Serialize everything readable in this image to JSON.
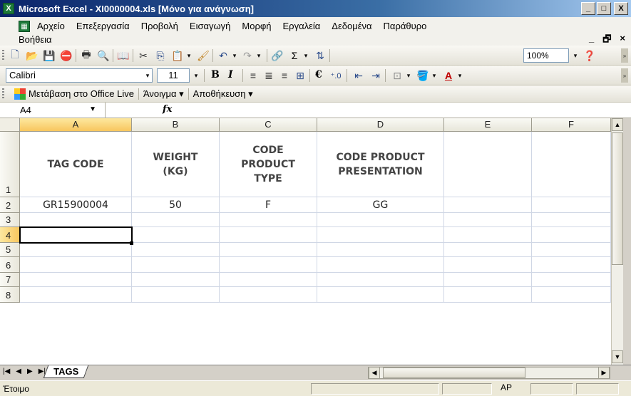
{
  "window": {
    "title": "Microsoft Excel - XI0000004.xls  [Μόνο για ανάγνωση]",
    "controls": {
      "minimize": "_",
      "maximize": "□",
      "close": "X"
    }
  },
  "menu": {
    "items": [
      "Αρχείο",
      "Επεξεργασία",
      "Προβολή",
      "Εισαγωγή",
      "Μορφή",
      "Εργαλεία",
      "Δεδομένα",
      "Παράθυρο"
    ],
    "second_row": "Βοήθεια",
    "mdi_controls": [
      "_",
      "🗗",
      "×"
    ]
  },
  "standard_toolbar": {
    "zoom": "100%"
  },
  "formatting_toolbar": {
    "font_name": "Calibri",
    "font_size": "11",
    "bold": "B",
    "italic": "I",
    "currency": "€"
  },
  "office_live_toolbar": {
    "goto": "Μετάβαση στο Office Live",
    "open": "Άνοιγμα ▾",
    "save": "Αποθήκευση ▾"
  },
  "formula_bar": {
    "name_box": "A4",
    "fx": "fx",
    "value": ""
  },
  "grid": {
    "columns": [
      "A",
      "B",
      "C",
      "D",
      "E",
      "F"
    ],
    "rows": [
      "1",
      "2",
      "3",
      "4",
      "5",
      "6",
      "7",
      "8"
    ],
    "header_cells": {
      "a1": "TAG CODE",
      "b1": "WEIGHT (KG)",
      "c1": "CODE PRODUCT TYPE",
      "d1": "CODE PRODUCT PRESENTATION"
    },
    "data_cells": {
      "a2": "GR15900004",
      "b2": "50",
      "c2": "F",
      "d2": "GG"
    },
    "selected_cell": "A4"
  },
  "sheet_tabs": [
    "TAGS"
  ],
  "status": {
    "left": "Έτοιμο",
    "indicator": "AP"
  }
}
